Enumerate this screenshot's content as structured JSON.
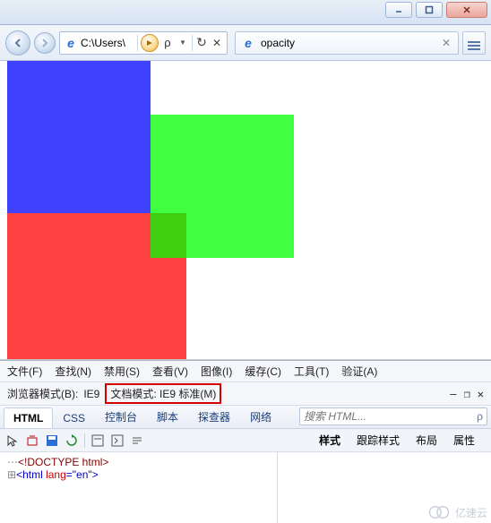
{
  "titlebar": {
    "minimize": "minimize",
    "maximize": "maximize",
    "close": "close"
  },
  "address": {
    "path": "C:\\Users\\",
    "dropdown": "▼",
    "search": "search",
    "refresh": "↻",
    "stop": "✕"
  },
  "tab": {
    "title": "opacity"
  },
  "devtools": {
    "menus": [
      "文件(F)",
      "查找(N)",
      "禁用(S)",
      "查看(V)",
      "图像(I)",
      "缓存(C)",
      "工具(T)",
      "验证(A)"
    ],
    "browser_mode_label": "浏览器模式(B):",
    "browser_mode_value": "IE9",
    "doc_mode_label": "文档模式:",
    "doc_mode_value": "IE9 标准(M)",
    "winctl": {
      "min": "—",
      "unpin": "❐",
      "close": "✕"
    },
    "tabs": [
      "HTML",
      "CSS",
      "控制台",
      "脚本",
      "探查器",
      "网络"
    ],
    "active_tab": "HTML",
    "search_placeholder": "搜索 HTML...",
    "side_tabs": [
      "样式",
      "跟踪样式",
      "布局",
      "属性"
    ],
    "active_side_tab": "样式",
    "tree": {
      "line1": "<!DOCTYPE html>",
      "line2_open": "<html ",
      "line2_attr": "lang",
      "line2_eq": "=",
      "line2_val": "\"en\"",
      "line2_close": ">"
    }
  },
  "watermark": "亿速云"
}
